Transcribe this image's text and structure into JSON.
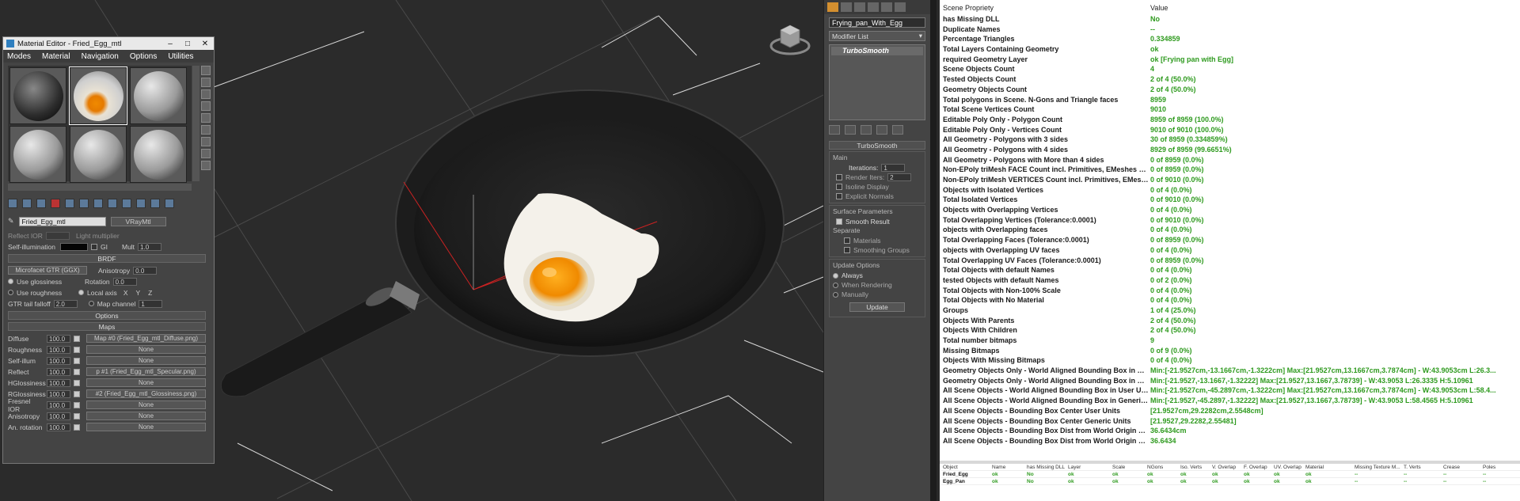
{
  "material_editor": {
    "title": "Material Editor - Fried_Egg_mtl",
    "menu": [
      "Modes",
      "Material",
      "Navigation",
      "Options",
      "Utilities"
    ],
    "material_name": "Fried_Egg_mtl",
    "material_type": "VRayMtl",
    "partial_row": {
      "a": "Reflect IOR",
      "b": "Light multiplier"
    },
    "self_illum": {
      "label": "Self-illumination",
      "gi": "GI",
      "mult_label": "Mult",
      "mult": "1.0"
    },
    "brdf": {
      "header": "BRDF",
      "type": "Microfacet GTR (GGX)",
      "use_glossiness": "Use glossiness",
      "use_roughness": "Use roughness",
      "anisotropy_label": "Anisotropy",
      "anisotropy": "0.0",
      "rotation_label": "Rotation",
      "rotation": "0.0",
      "local_axis": "Local axis",
      "x": "X",
      "y": "Y",
      "z": "Z",
      "map_channel": "Map channel",
      "map_channel_val": "1",
      "gtr_label": "GTR tail falloff",
      "gtr": "2.0"
    },
    "options_header": "Options",
    "maps_header": "Maps",
    "maps": [
      {
        "label": "Diffuse",
        "value": "100.0",
        "map": "Map #0 (Fried_Egg_mtl_Diffuse.png)"
      },
      {
        "label": "Roughness",
        "value": "100.0",
        "map": "None"
      },
      {
        "label": "Self-illum",
        "value": "100.0",
        "map": "None"
      },
      {
        "label": "Reflect",
        "value": "100.0",
        "map": "p #1 (Fried_Egg_mtl_Specular.png)"
      },
      {
        "label": "HGlossiness",
        "value": "100.0",
        "map": "None"
      },
      {
        "label": "RGlossiness",
        "value": "100.0",
        "map": "#2 (Fried_Egg_mtl_Glossiness.png)"
      },
      {
        "label": "Fresnel IOR",
        "value": "100.0",
        "map": "None"
      },
      {
        "label": "Anisotropy",
        "value": "100.0",
        "map": "None"
      },
      {
        "label": "An. rotation",
        "value": "100.0",
        "map": "None"
      }
    ]
  },
  "modifier_panel": {
    "object_name": "Frying_pan_With_Egg",
    "modifier_list": "Modifier List",
    "stack_item": "TurboSmooth",
    "turbosmooth_header": "TurboSmooth",
    "main": "Main",
    "iterations_label": "Iterations:",
    "iterations": "1",
    "render_iters": "Render Iters:",
    "render_iters_val": "2",
    "isoline": "Isoline Display",
    "explicit": "Explicit Normals",
    "surface": "Surface Parameters",
    "smooth_result": "Smooth Result",
    "separate": "Separate",
    "materials": "Materials",
    "smoothing_groups": "Smoothing Groups",
    "update_options": "Update Options",
    "always": "Always",
    "when_rendering": "When Rendering",
    "manually": "Manually",
    "update": "Update"
  },
  "report": {
    "header": {
      "property": "Scene Propriety",
      "value": "Value"
    },
    "rows": [
      [
        "has Missing DLL",
        "No"
      ],
      [
        "Duplicate Names",
        "--"
      ],
      [
        "Percentage Triangles",
        "0.334859"
      ],
      [
        "Total Layers Containing Geometry",
        "ok"
      ],
      [
        "required Geometry Layer",
        "ok [Frying pan with Egg]"
      ],
      [
        "Scene Objects Count",
        "4"
      ],
      [
        "Tested Objects Count",
        "2 of 4 (50.0%)"
      ],
      [
        "Geometry Objects Count",
        "2 of 4 (50.0%)"
      ],
      [
        "Total polygons in Scene. N-Gons and Triangle faces",
        "8959"
      ],
      [
        "Total Scene Vertices Count",
        "9010"
      ],
      [
        "Editable Poly Only - Polygon Count",
        "8959 of 8959 (100.0%)"
      ],
      [
        "Editable Poly Only - Vertices Count",
        "9010 of 9010 (100.0%)"
      ],
      [
        "All Geometry - Polygons with 3 sides",
        "30 of 8959 (0.334859%)"
      ],
      [
        "All Geometry - Polygons with 4 sides",
        "8929 of 8959 (99.6651%)"
      ],
      [
        "All Geometry - Polygons with More than 4 sides",
        "0 of 8959 (0.0%)"
      ],
      [
        "Non-EPoly triMesh FACE Count incl. Primitives, EMeshes etc...",
        "0 of 8959 (0.0%)"
      ],
      [
        "Non-EPoly triMesh VERTICES Count incl. Primitives, EMeshes etc...",
        "0 of 9010 (0.0%)"
      ],
      [
        "Objects with Isolated Vertices",
        "0 of 4 (0.0%)"
      ],
      [
        "Total Isolated Vertices",
        "0 of 9010 (0.0%)"
      ],
      [
        "Objects with Overlapping Vertices",
        "0 of 4 (0.0%)"
      ],
      [
        "Total Overlapping Vertices (Tolerance:0.0001)",
        "0 of 9010 (0.0%)"
      ],
      [
        "objects with Overlapping faces",
        "0 of 4 (0.0%)"
      ],
      [
        "Total Overlapping Faces (Tolerance:0.0001)",
        "0 of 8959 (0.0%)"
      ],
      [
        "objects with Overlapping UV faces",
        "0 of 4 (0.0%)"
      ],
      [
        "Total Overlapping UV Faces (Tolerance:0.0001)",
        "0 of 8959 (0.0%)"
      ],
      [
        "Total Objects with default Names",
        "0 of 4 (0.0%)"
      ],
      [
        "tested Objects with default Names",
        "0 of 2 (0.0%)"
      ],
      [
        "Total Objects with Non-100% Scale",
        "0 of 4 (0.0%)"
      ],
      [
        "Total Objects with No Material",
        "0 of 4 (0.0%)"
      ],
      [
        "Groups",
        "1 of 4 (25.0%)"
      ],
      [
        "Objects With Parents",
        "2 of 4 (50.0%)"
      ],
      [
        "Objects With Children",
        "2 of 4 (50.0%)"
      ],
      [
        "Total number bitmaps",
        "9"
      ],
      [
        "Missing Bitmaps",
        "0 of 9 (0.0%)"
      ],
      [
        "Objects With Missing Bitmaps",
        "0 of 4 (0.0%)"
      ],
      [
        "Geometry Objects Only - World Aligned Bounding Box in User Units",
        "Min:[-21.9527cm,-13.1667cm,-1.3222cm]  Max:[21.9527cm,13.1667cm,3.7874cm] - W:43.9053cm L:26.3..."
      ],
      [
        "Geometry Objects Only - World Aligned Bounding Box in Generic Units",
        "Min:[-21.9527,-13.1667,-1.32222]  Max:[21.9527,13.1667,3.78739] - W:43.9053 L:26.3335 H:5.10961"
      ],
      [
        "All Scene Objects - World Aligned Bounding Box in User Units",
        "Min:[-21.9527cm,-45.2897cm,-1.3222cm]  Max:[21.9527cm,13.1667cm,3.7874cm] - W:43.9053cm L:58.4..."
      ],
      [
        "All Scene Objects - World Aligned Bounding Box in Generic Units",
        "Min:[-21.9527,-45.2897,-1.32222]  Max:[21.9527,13.1667,3.78739] - W:43.9053 L:58.4565 H:5.10961"
      ],
      [
        "All Scene Objects - Bounding Box Center User Units",
        "[21.9527cm,29.2282cm,2.5548cm]"
      ],
      [
        "All Scene Objects - Bounding Box Center Generic Units",
        "[21.9527,29.2282,2.55481]"
      ],
      [
        "All Scene Objects - Bounding Box Dist from World Origin User Units",
        "36.6434cm"
      ],
      [
        "All Scene Objects - Bounding Box Dist from World Origin Generic Units",
        "36.6434"
      ]
    ]
  },
  "objects_table": {
    "columns": [
      "Object",
      "Name",
      "has Missing DLL",
      "Layer",
      "Scale",
      "NGons",
      "Iso. Verts",
      "V. Overlap",
      "F. Overlap",
      "UV. Overlap",
      "Material",
      "Missing Texture M...",
      "T. Verts",
      "Crease",
      "Poles"
    ],
    "rows": [
      [
        "Fried_Egg",
        "ok",
        "No",
        "ok",
        "ok",
        "ok",
        "ok",
        "ok",
        "ok",
        "ok",
        "ok",
        "--",
        "--",
        "--",
        "--"
      ],
      [
        "Egg_Pan",
        "ok",
        "No",
        "ok",
        "ok",
        "ok",
        "ok",
        "ok",
        "ok",
        "ok",
        "ok",
        "--",
        "--",
        "--",
        "--"
      ]
    ]
  },
  "colors": {
    "report_value": "#2e9a1e",
    "active_tab": "#d38f2f"
  }
}
